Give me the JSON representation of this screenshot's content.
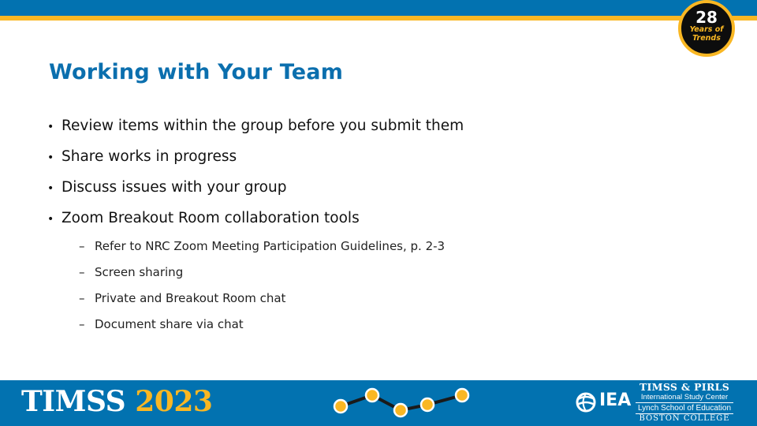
{
  "badge": {
    "number": "28",
    "line1": "Years of",
    "line2": "Trends"
  },
  "title": "Working with Your Team",
  "bullets": [
    "Review items within the group before you submit them",
    "Share works in progress",
    "Discuss issues with your group",
    "Zoom Breakout Room collaboration tools"
  ],
  "bullet_glyph": "•",
  "sub_glyph": "–",
  "sub_bullets": [
    "Refer to NRC Zoom Meeting Participation Guidelines, p. 2-3",
    "Screen sharing",
    "Private and Breakout Room chat",
    "Document share via chat"
  ],
  "footer": {
    "timss_word": "TIMSS",
    "timss_year": "2023",
    "iea_label": "IEA",
    "center_line1": "TIMSS & PIRLS",
    "center_line2": "International Study Center",
    "center_line3": "Lynch School of Education",
    "center_line4": "BOSTON COLLEGE"
  },
  "colors": {
    "brand_blue": "#0272b0",
    "brand_yellow": "#f9b723",
    "title_blue": "#0b6fae"
  }
}
